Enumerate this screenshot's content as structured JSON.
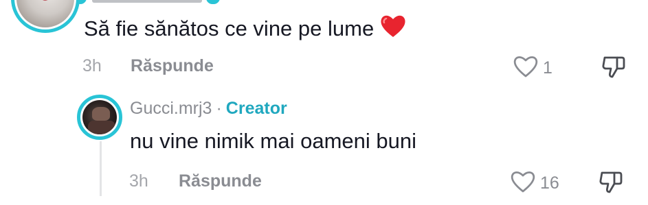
{
  "comment": {
    "text": "Să fie sănătos ce vine pe lume",
    "emoji": "❤️",
    "time": "3h",
    "reply_label": "Răspunde",
    "likes": "1"
  },
  "reply": {
    "username": "Gucci.mrj3",
    "separator": "·",
    "badge": "Creator",
    "text": "nu vine nimik mai oameni buni",
    "time": "3h",
    "reply_label": "Răspunde",
    "likes": "16"
  },
  "icons": {
    "like": "heart-outline-icon",
    "dislike": "thumbs-down-icon",
    "emoji": "red-heart-emoji"
  },
  "colors": {
    "avatar_ring": "#29c4d6",
    "creator_badge": "#20a8bf",
    "secondary_text": "#8a8c92"
  }
}
